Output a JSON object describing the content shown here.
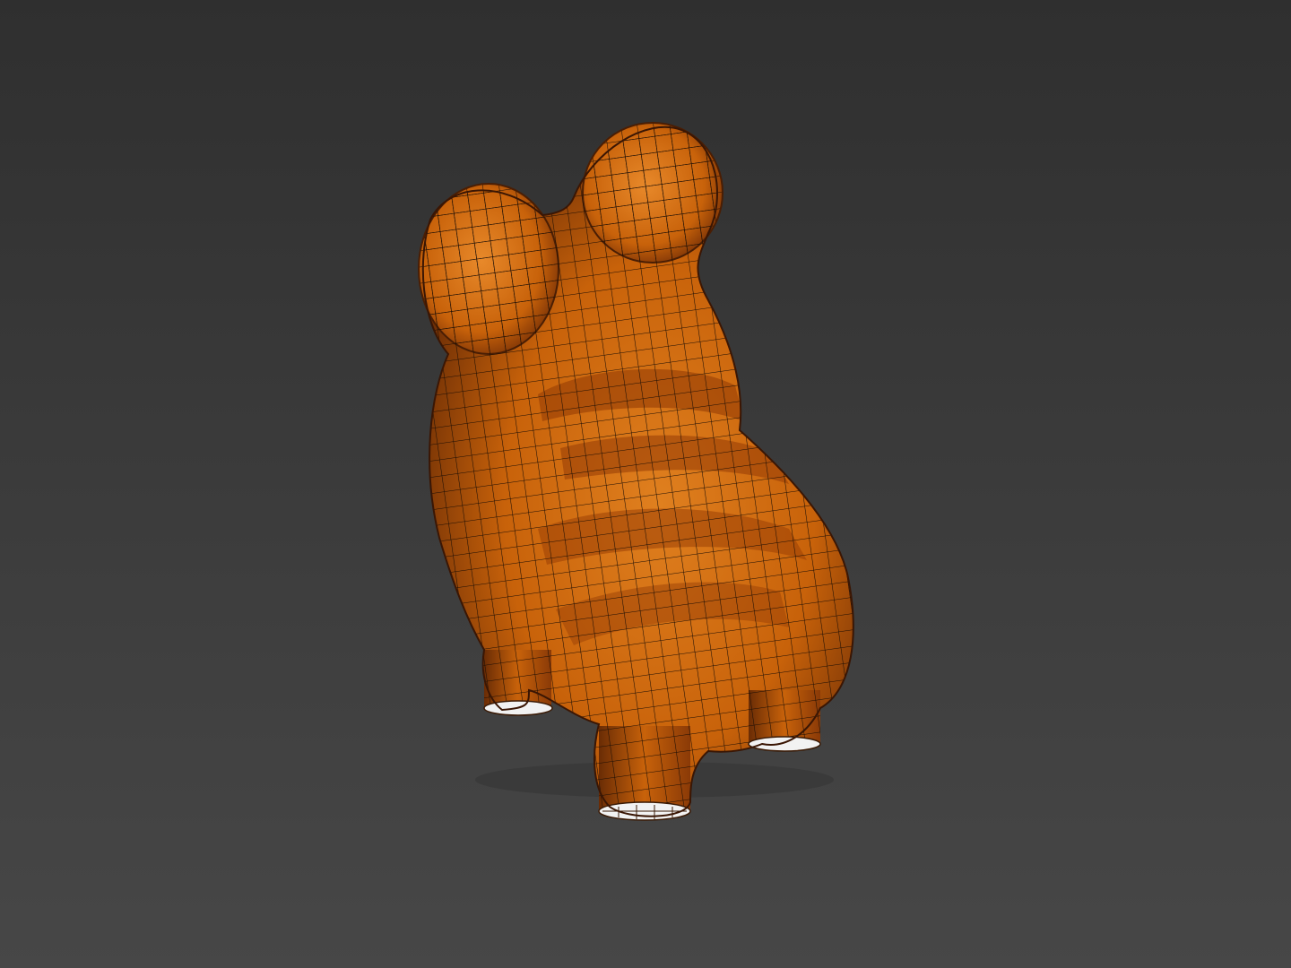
{
  "viewport": {
    "background_top": "#2f2f2f",
    "background_bottom": "#474747"
  },
  "model": {
    "icon": "wireframe-creature-model",
    "fill": "#c8620a",
    "fill_highlight": "#e8892a",
    "fill_shadow": "#7a3206",
    "wire_color": "#1a0d05",
    "foot_cap_color": "#f2f2f2"
  }
}
